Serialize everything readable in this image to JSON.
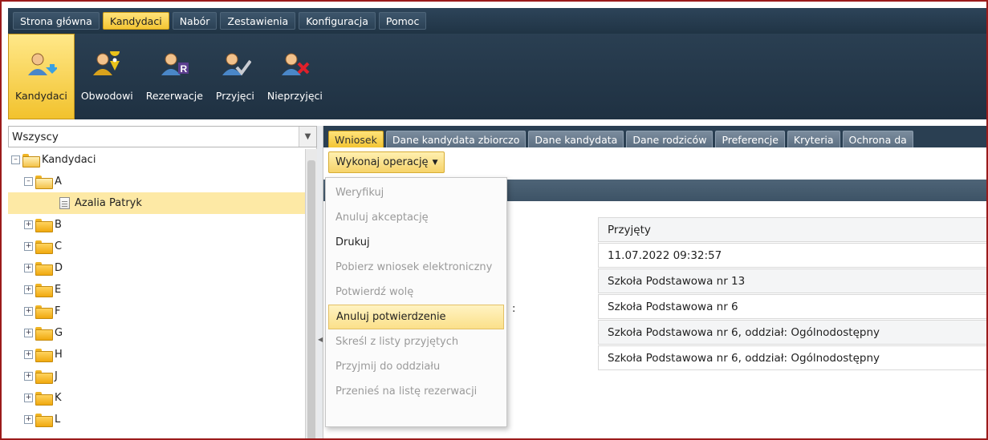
{
  "menubar": {
    "tabs": [
      {
        "label": "Strona główna",
        "active": false
      },
      {
        "label": "Kandydaci",
        "active": true
      },
      {
        "label": "Nabór",
        "active": false
      },
      {
        "label": "Zestawienia",
        "active": false
      },
      {
        "label": "Konfiguracja",
        "active": false
      },
      {
        "label": "Pomoc",
        "active": false
      }
    ]
  },
  "toolbar": {
    "buttons": [
      {
        "label": "Kandydaci",
        "icon": "person-up-arrow-icon",
        "active": true
      },
      {
        "label": "Obwodowi",
        "icon": "person-location-pin-icon",
        "active": false
      },
      {
        "label": "Rezerwacje",
        "icon": "person-r-badge-icon",
        "active": false
      },
      {
        "label": "Przyjęci",
        "icon": "person-checkmark-icon",
        "active": false
      },
      {
        "label": "Nieprzyjęci",
        "icon": "person-red-x-icon",
        "active": false
      }
    ]
  },
  "filter": {
    "value": "Wszyscy"
  },
  "tree": {
    "root": "Kandydaci",
    "expanded_group": "A",
    "selected_item": "Azalia Patryk",
    "groups": [
      "B",
      "C",
      "D",
      "E",
      "F",
      "G",
      "H",
      "J",
      "K",
      "L"
    ]
  },
  "tabs": [
    {
      "label": "Wniosek",
      "active": true
    },
    {
      "label": "Dane kandydata zbiorczo",
      "active": false
    },
    {
      "label": "Dane kandydata",
      "active": false
    },
    {
      "label": "Dane rodziców",
      "active": false
    },
    {
      "label": "Preferencje",
      "active": false
    },
    {
      "label": "Kryteria",
      "active": false
    },
    {
      "label": "Ochrona da",
      "active": false
    }
  ],
  "operation_button": {
    "label": "Wykonaj operację"
  },
  "context_menu": {
    "items": [
      {
        "label": "Weryfikuj",
        "enabled": false
      },
      {
        "label": "Anuluj akceptację",
        "enabled": false
      },
      {
        "label": "Drukuj",
        "enabled": true
      },
      {
        "label": "Pobierz wniosek elektroniczny",
        "enabled": false
      },
      {
        "label": "Potwierdź wolę",
        "enabled": false
      },
      {
        "label": "Anuluj potwierdzenie",
        "enabled": true,
        "hover": true
      },
      {
        "label": "Skreśl z listy przyjętych",
        "enabled": false
      },
      {
        "label": "Przyjmij do oddziału",
        "enabled": false
      },
      {
        "label": "Przenieś na listę rezerwacji",
        "enabled": false
      }
    ]
  },
  "details": {
    "partial_label_fragment": ":",
    "values": [
      "Przyjęty",
      "11.07.2022 09:32:57",
      "Szkoła Podstawowa nr 13",
      "Szkoła Podstawowa nr 6",
      "Szkoła Podstawowa nr 6, oddział: Ogólnodostępny",
      "Szkoła Podstawowa nr 6, oddział: Ogólnodostępny"
    ]
  },
  "colors": {
    "accent_yellow": "#f3c533",
    "navy": "#2a3f52",
    "frame_red": "#9b1b1b",
    "selection": "#fde9a5"
  }
}
